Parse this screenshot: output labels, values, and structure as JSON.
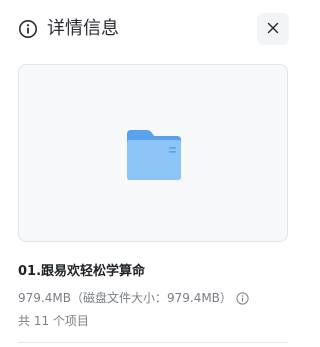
{
  "header": {
    "title": "详情信息",
    "info_icon": "info-circle-icon",
    "close_icon": "close-icon"
  },
  "preview": {
    "icon": "folder-icon",
    "folder_color": "#7ab8f5",
    "folder_tab_color": "#5aa2ec"
  },
  "details": {
    "name": "01.跟易欢轻松学算命",
    "size": "979.4MB",
    "disk_size_label": "（磁盘文件大小：",
    "disk_size": "979.4MB",
    "disk_size_close": "）",
    "size_info_icon": "info-circle-icon",
    "count_text": "共 11 个项目"
  },
  "colors": {
    "preview_bg": "#f7f8fa",
    "border": "#e3e5e8",
    "secondary_text": "#7a7f87"
  }
}
